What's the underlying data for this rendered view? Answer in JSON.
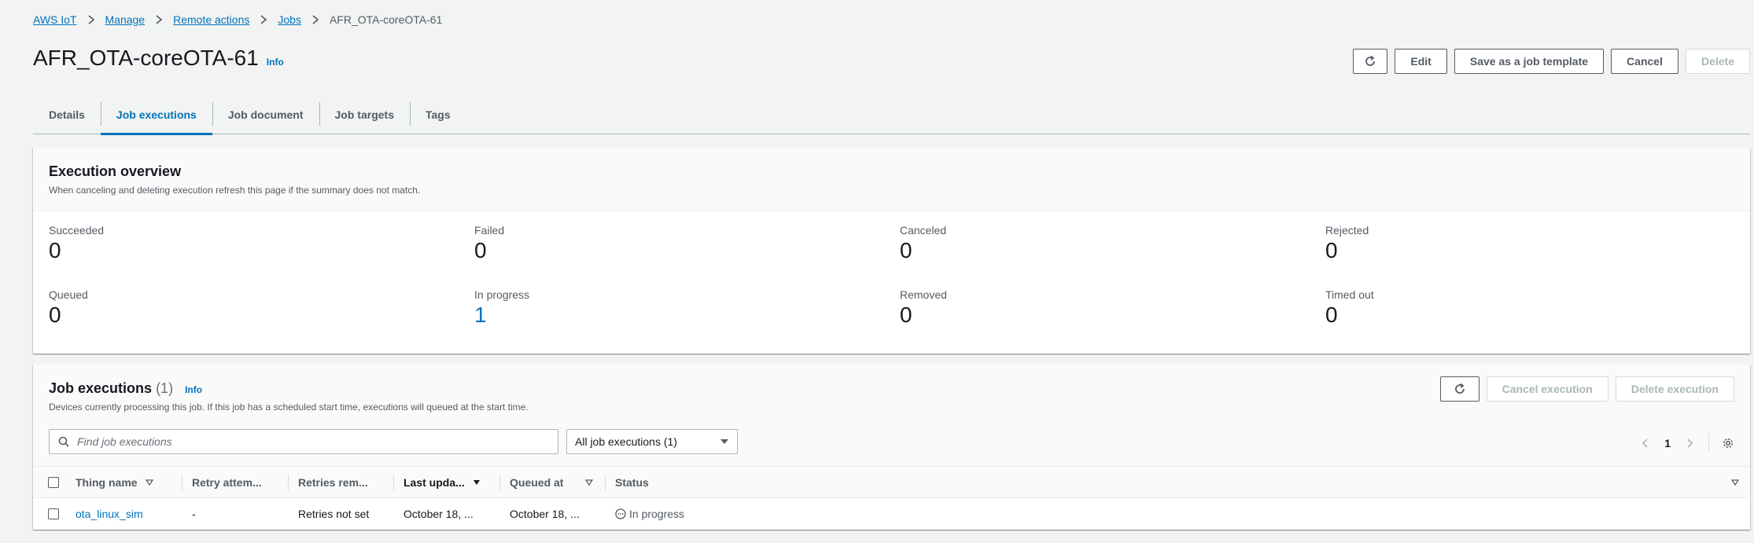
{
  "breadcrumb": {
    "items": [
      "AWS IoT",
      "Manage",
      "Remote actions",
      "Jobs"
    ],
    "current": "AFR_OTA-coreOTA-61"
  },
  "page": {
    "title": "AFR_OTA-coreOTA-61",
    "info": "Info"
  },
  "header_actions": {
    "refresh_icon": "refresh-icon",
    "edit": "Edit",
    "save_template": "Save as a job template",
    "cancel": "Cancel",
    "delete": "Delete"
  },
  "tabs": [
    {
      "label": "Details",
      "active": false
    },
    {
      "label": "Job executions",
      "active": true
    },
    {
      "label": "Job document",
      "active": false
    },
    {
      "label": "Job targets",
      "active": false
    },
    {
      "label": "Tags",
      "active": false
    }
  ],
  "overview": {
    "title": "Execution overview",
    "description": "When canceling and deleting execution refresh this page if the summary does not match.",
    "stats": [
      {
        "label": "Succeeded",
        "value": "0"
      },
      {
        "label": "Failed",
        "value": "0"
      },
      {
        "label": "Canceled",
        "value": "0"
      },
      {
        "label": "Rejected",
        "value": "0"
      },
      {
        "label": "Queued",
        "value": "0"
      },
      {
        "label": "In progress",
        "value": "1"
      },
      {
        "label": "Removed",
        "value": "0"
      },
      {
        "label": "Timed out",
        "value": "0"
      }
    ]
  },
  "executions": {
    "title": "Job executions",
    "count": "(1)",
    "info": "Info",
    "description": "Devices currently processing this job. If this job has a scheduled start time, executions will queued at the start time.",
    "cancel_execution": "Cancel execution",
    "delete_execution": "Delete execution",
    "search_placeholder": "Find job executions",
    "filter_value": "All job executions (1)",
    "page": "1",
    "columns": [
      "Thing name",
      "Retry attem...",
      "Retries rem...",
      "Last upda...",
      "Queued at",
      "Status"
    ],
    "rows": [
      {
        "thing_name": "ota_linux_sim",
        "retry_attempt": "-",
        "retries_remaining": "Retries not set",
        "last_updated": "October 18, ...",
        "queued_at": "October 18, ...",
        "status": "In progress"
      }
    ]
  },
  "colors": {
    "link": "#0073bb",
    "text": "#16191f",
    "muted": "#545b64",
    "background": "#f2f3f3"
  }
}
